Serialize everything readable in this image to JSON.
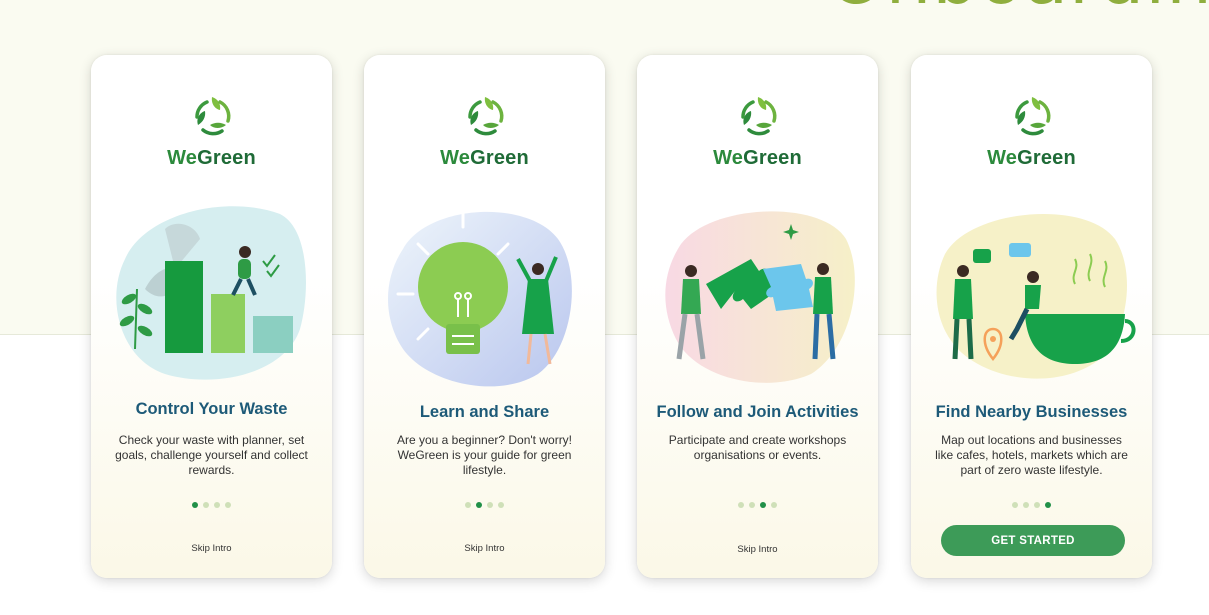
{
  "page": {
    "heading": "Onboarding"
  },
  "brand": {
    "name_part1": "We",
    "name_part2": "Green",
    "primary_color": "#219048",
    "title_color": "#1d5a78",
    "heading_color": "#8fae3e"
  },
  "screens": [
    {
      "title": "Control Your Waste",
      "description": "Check your waste with planner, set goals, challenge yourself and collect rewards.",
      "illustration": "chart-person-illustration",
      "dots_total": 4,
      "active_dot": 1,
      "skip_label": "Skip Intro"
    },
    {
      "title": "Learn and Share",
      "description": "Are you a beginner? Don't worry! WeGreen is your guide for green lifestyle.",
      "illustration": "lightbulb-person-illustration",
      "dots_total": 4,
      "active_dot": 2,
      "skip_label": "Skip Intro"
    },
    {
      "title": "Follow and Join Activities",
      "description": "Participate and create workshops organisations or events.",
      "illustration": "puzzle-people-illustration",
      "dots_total": 4,
      "active_dot": 3,
      "skip_label": "Skip Intro"
    },
    {
      "title": "Find Nearby Businesses",
      "description": "Map out locations and businesses like cafes, hotels, markets which are part of zero waste lifestyle.",
      "illustration": "cafe-people-illustration",
      "dots_total": 4,
      "active_dot": 4,
      "cta_label": "GET STARTED"
    }
  ]
}
